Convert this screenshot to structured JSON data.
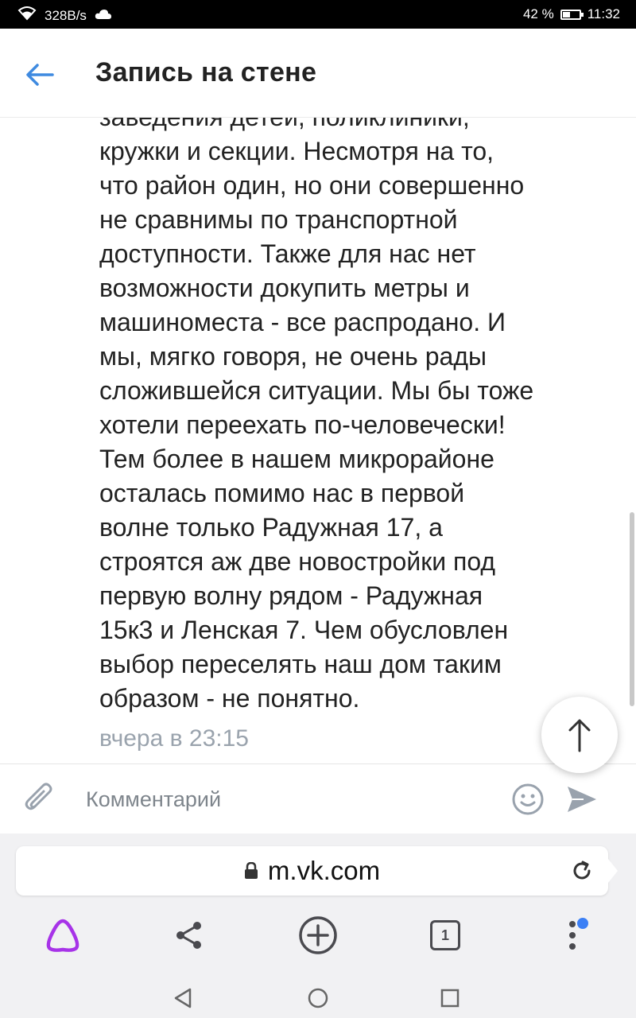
{
  "status_bar": {
    "network_speed": "328B/s",
    "battery_percent": "42 %",
    "battery_level": 0.42,
    "time": "11:32",
    "icons": [
      "wifi-icon",
      "cloud-icon",
      "battery-icon"
    ]
  },
  "header": {
    "title": "Запись на стене",
    "back_icon": "arrow-left-icon"
  },
  "post": {
    "text": "заведения детей, поликлиники,\nкружки и секции. Несмотря на то,\nчто район один, но они совершенно\nне сравнимы по транспортной\nдоступности. Также для нас нет\nвозможности докупить метры и\nмашиноместа - все распродано. И\nмы, мягко говоря, не очень рады\nсложившейся ситуации. Мы бы тоже\nхотели переехать по-человечески!\nТем более в нашем микрорайоне\nосталась помимо нас в первой\nволне только Радужная 17, а\nстроятся аж две новостройки под\nпервую волну рядом - Радужная\n15к3 и Ленская 7. Чем обусловлен\nвыбор переселять наш дом таким\nобразом - не понятно.",
    "timestamp": "вчера в 23:15"
  },
  "comment_bar": {
    "placeholder": "Комментарий",
    "icons": [
      "paperclip-icon",
      "emoji-icon",
      "send-icon"
    ]
  },
  "browser": {
    "url": "m.vk.com",
    "tab_count": "1",
    "icons": [
      "lock-icon",
      "reload-icon",
      "alice-icon",
      "share-icon",
      "new-tab-icon",
      "tabs-icon",
      "menu-icon"
    ]
  },
  "colors": {
    "accent": "#3f8ae0",
    "alice": "#a733e8",
    "timestamp": "#9aa3ad",
    "notification_dot": "#3b7ff5"
  }
}
